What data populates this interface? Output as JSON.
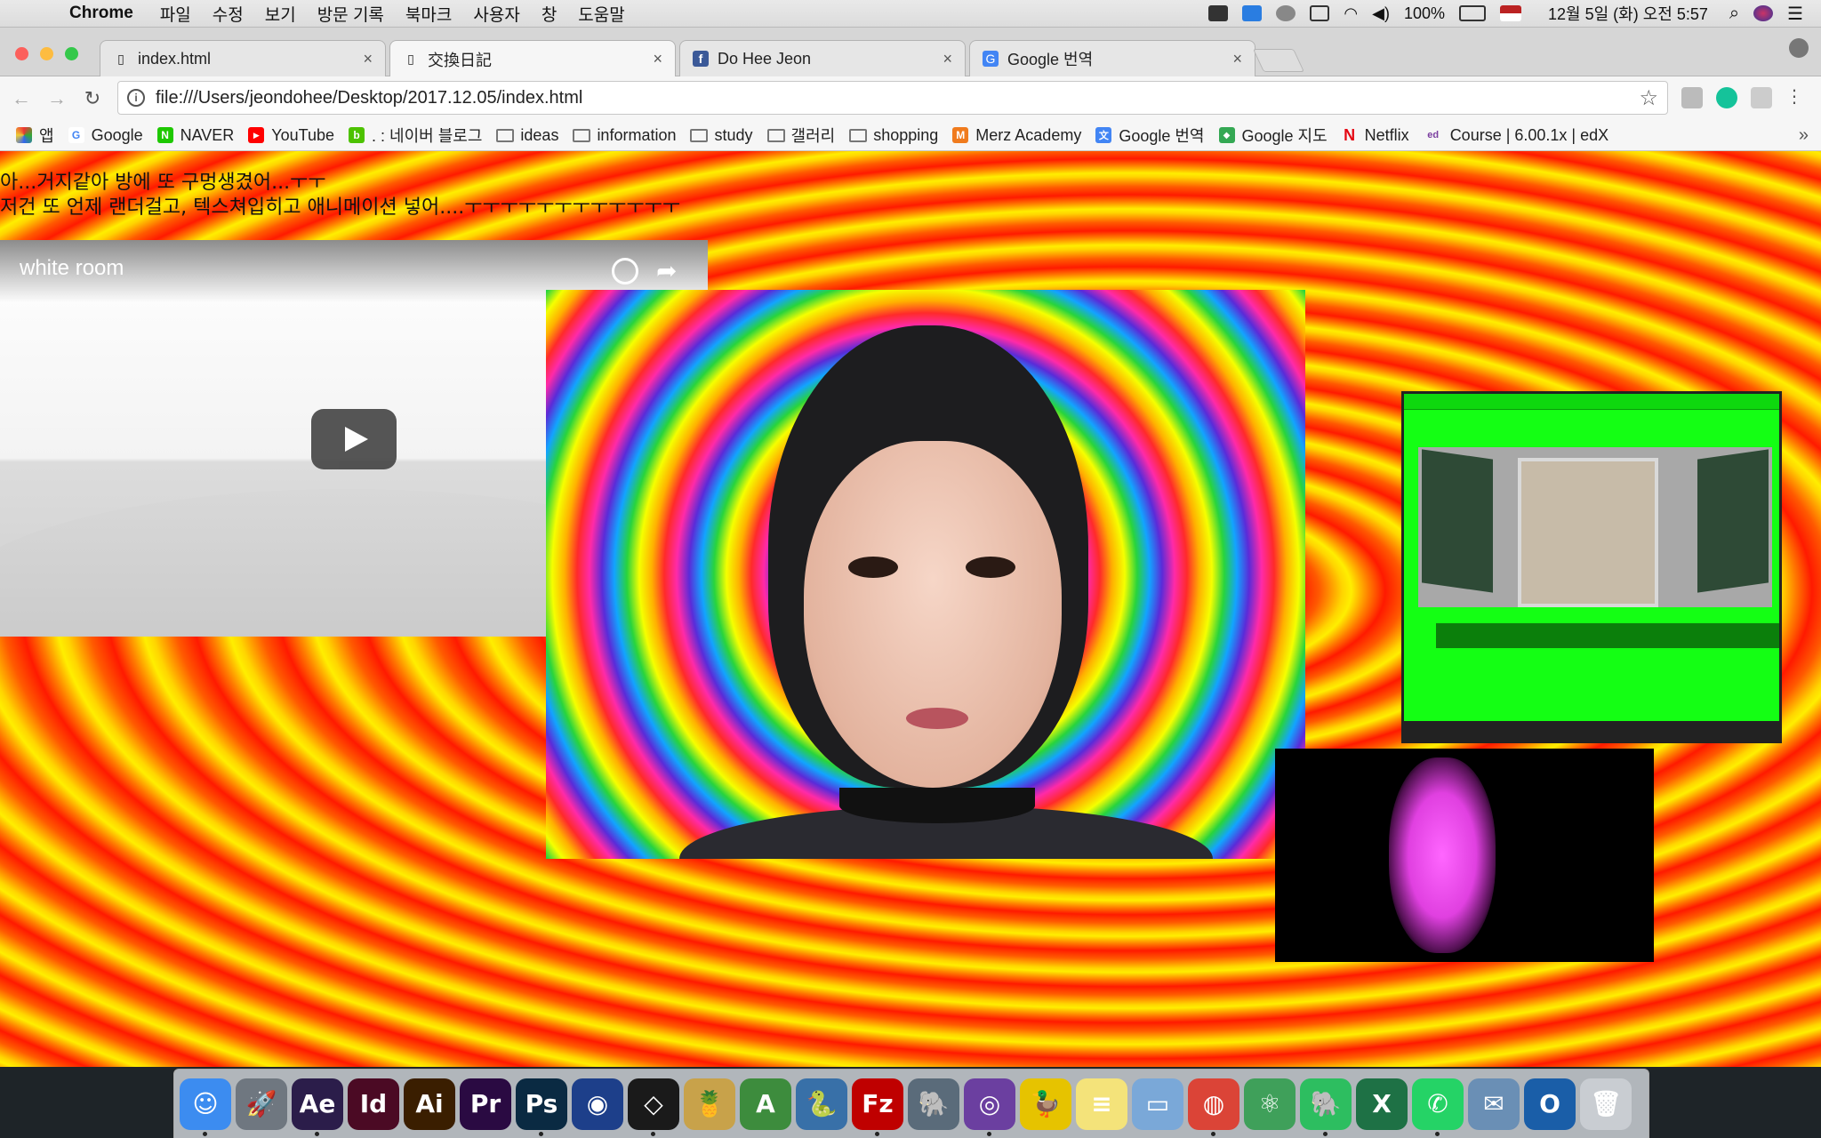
{
  "menubar": {
    "apple": "",
    "app": "Chrome",
    "items": [
      "파일",
      "수정",
      "보기",
      "방문 기록",
      "북마크",
      "사용자",
      "창",
      "도움말"
    ],
    "battery": "100%",
    "datetime": "12월 5일 (화) 오전 5:57"
  },
  "tabs": [
    {
      "label": "index.html",
      "favicon": "page-icon",
      "active": false
    },
    {
      "label": "交換日記",
      "favicon": "page-icon",
      "active": true
    },
    {
      "label": "Do Hee Jeon",
      "favicon": "facebook-icon",
      "active": false
    },
    {
      "label": "Google 번역",
      "favicon": "google-translate-icon",
      "active": false
    }
  ],
  "tab_close": "×",
  "toolbar": {
    "back": "←",
    "forward": "→",
    "reload": "↻",
    "info": "i",
    "url": "file:///Users/jeondohee/Desktop/2017.12.05/index.html",
    "star": "☆"
  },
  "bookmarks": [
    {
      "label": "앱",
      "icon": "apps-icon",
      "color": "#4a7be0"
    },
    {
      "label": "Google",
      "icon": "google-icon",
      "color": "#4285f4",
      "glyph": "G"
    },
    {
      "label": "NAVER",
      "icon": "naver-icon",
      "color": "#1ec800",
      "glyph": "N"
    },
    {
      "label": "YouTube",
      "icon": "youtube-icon",
      "color": "#ff0000",
      "glyph": "▶"
    },
    {
      "label": ". : 네이버 블로그",
      "icon": "naver-blog-icon",
      "color": "#4dc200",
      "glyph": "b"
    },
    {
      "label": "ideas",
      "icon": "folder-icon"
    },
    {
      "label": "information",
      "icon": "folder-icon"
    },
    {
      "label": "study",
      "icon": "folder-icon"
    },
    {
      "label": "갤러리",
      "icon": "folder-icon"
    },
    {
      "label": "shopping",
      "icon": "folder-icon"
    },
    {
      "label": "Merz Academy",
      "icon": "merz-icon",
      "color": "#f07b1d",
      "glyph": "M"
    },
    {
      "label": "Google 번역",
      "icon": "google-translate-icon",
      "color": "#4285f4",
      "glyph": "文"
    },
    {
      "label": "Google 지도",
      "icon": "google-maps-icon",
      "color": "#34a853",
      "glyph": "◆"
    },
    {
      "label": "Netflix",
      "icon": "netflix-icon",
      "color": "#e50914",
      "glyph": "N"
    },
    {
      "label": "Course | 6.00.1x | edX",
      "icon": "edx-icon",
      "color": "#7b3fa0",
      "glyph": "ed"
    }
  ],
  "bookmarks_more": "»",
  "page": {
    "line1": "아...거지같아 방에 또 구멍생겼어...ㅜㅜ",
    "line2": "저건 또 언제 랜더걸고, 텍스쳐입히고 애니메이션 넣어....ㅜㅜㅜㅜㅜㅜㅜㅜㅜㅜㅜㅜ",
    "video_title": "white room",
    "share_glyph": "➦"
  },
  "dock": [
    {
      "name": "finder-icon",
      "label": "☺",
      "color": "#3c8cf0",
      "running": true
    },
    {
      "name": "launchpad-icon",
      "label": "🚀",
      "color": "#6f7780",
      "running": false
    },
    {
      "name": "after-effects-icon",
      "label": "Ae",
      "color": "#2b1d4a",
      "running": true
    },
    {
      "name": "indesign-icon",
      "label": "Id",
      "color": "#4b0a24",
      "running": false
    },
    {
      "name": "illustrator-icon",
      "label": "Ai",
      "color": "#3a1e00",
      "running": false
    },
    {
      "name": "premiere-icon",
      "label": "Pr",
      "color": "#2a0a42",
      "running": false
    },
    {
      "name": "photoshop-icon",
      "label": "Ps",
      "color": "#0a2a42",
      "running": true
    },
    {
      "name": "cinema4d-icon",
      "label": "◉",
      "color": "#1d3f8a",
      "running": false
    },
    {
      "name": "unity-icon",
      "label": "◇",
      "color": "#1a1a1a",
      "running": true
    },
    {
      "name": "cocktail-icon",
      "label": "🍍",
      "color": "#c8a24a",
      "running": false
    },
    {
      "name": "android-studio-icon",
      "label": "A",
      "color": "#3d8c3d",
      "running": false
    },
    {
      "name": "python-icon",
      "label": "🐍",
      "color": "#3870a8",
      "running": false
    },
    {
      "name": "filezilla-icon",
      "label": "Fz",
      "color": "#bf0000",
      "running": true
    },
    {
      "name": "sequel-pro-icon",
      "label": "🐘",
      "color": "#5a6b7a",
      "running": false
    },
    {
      "name": "github-icon",
      "label": "◎",
      "color": "#6b3fa0",
      "running": true
    },
    {
      "name": "cyberduck-icon",
      "label": "🦆",
      "color": "#e6c300",
      "running": false
    },
    {
      "name": "notes-icon",
      "label": "≡",
      "color": "#f4e37a",
      "running": false
    },
    {
      "name": "preview-icon",
      "label": "▭",
      "color": "#7aa8d8",
      "running": false
    },
    {
      "name": "chrome-icon",
      "label": "◍",
      "color": "#db4437",
      "running": true
    },
    {
      "name": "atom-icon",
      "label": "⚛",
      "color": "#3fa05a",
      "running": false
    },
    {
      "name": "evernote-icon",
      "label": "🐘",
      "color": "#2dbe60",
      "running": true
    },
    {
      "name": "excel-icon",
      "label": "X",
      "color": "#1e7145",
      "running": false
    },
    {
      "name": "whatsapp-icon",
      "label": "✆",
      "color": "#25d366",
      "running": true
    },
    {
      "name": "mail-hawk-icon",
      "label": "✉",
      "color": "#6a8fb5",
      "running": false
    },
    {
      "name": "outlook-icon",
      "label": "O",
      "color": "#1a5ea8",
      "running": false
    },
    {
      "name": "trash-icon",
      "label": "🗑",
      "color": "#c9cdd2",
      "running": false
    }
  ]
}
